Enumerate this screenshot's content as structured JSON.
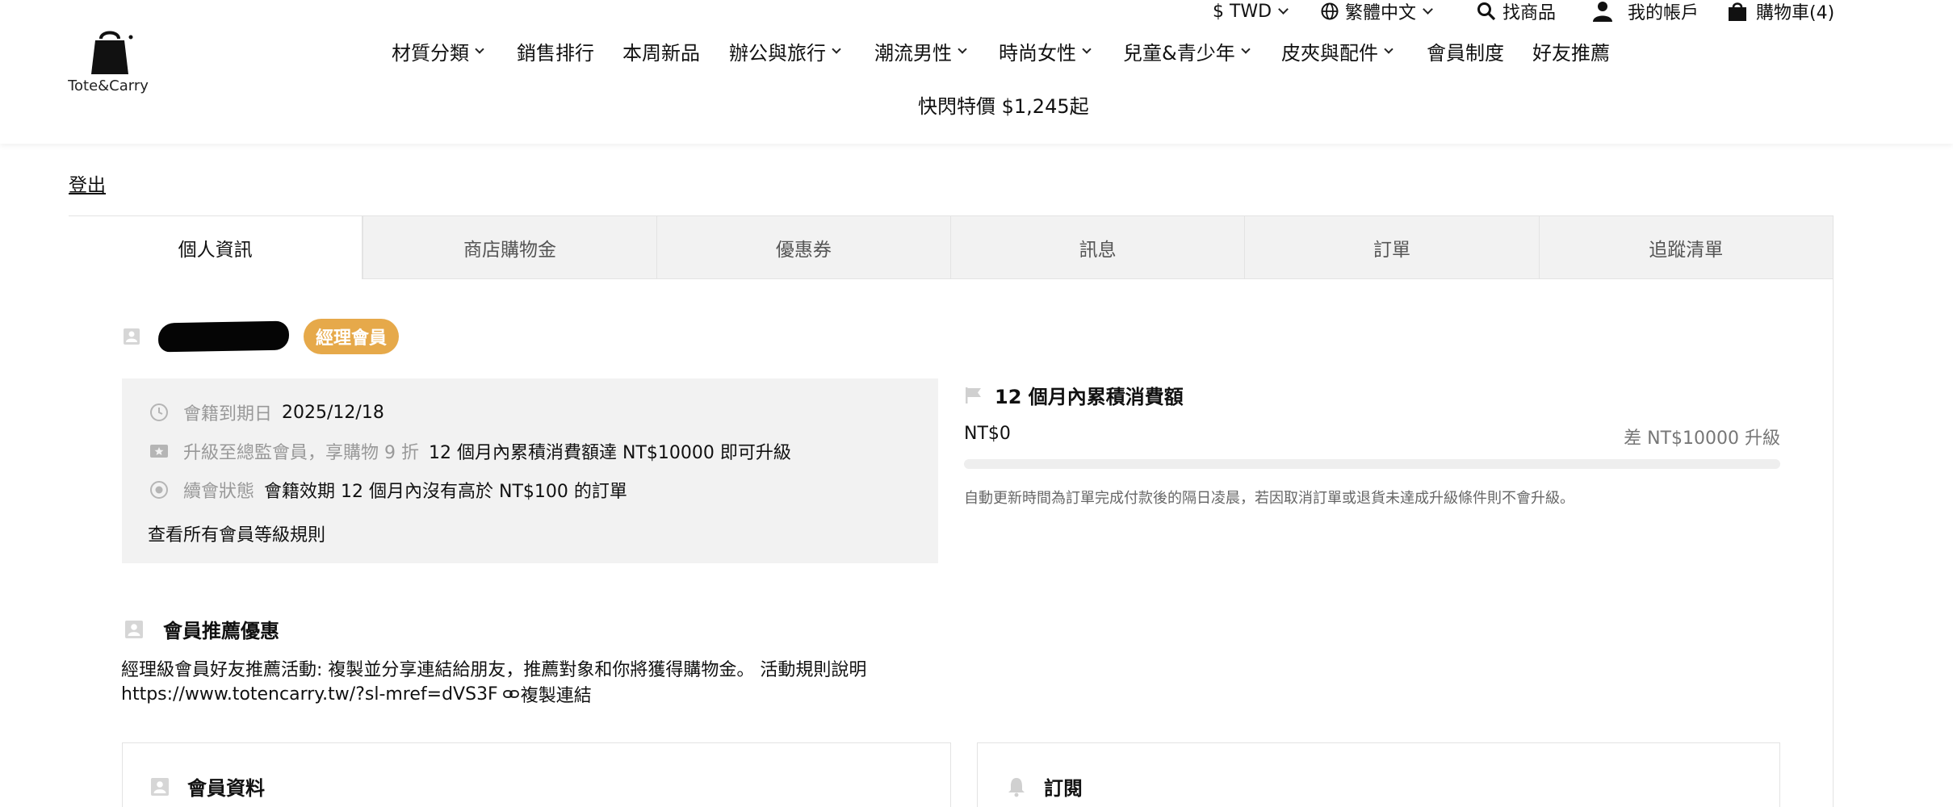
{
  "brand": {
    "name": "Tote&Carry"
  },
  "utility": {
    "currency": "$ TWD",
    "language": "繁體中文",
    "search": "找商品",
    "account": "我的帳戶",
    "cart": "購物車(4)"
  },
  "nav": {
    "items": [
      {
        "label": "材質分類",
        "dropdown": true
      },
      {
        "label": "銷售排行",
        "dropdown": false
      },
      {
        "label": "本周新品",
        "dropdown": false
      },
      {
        "label": "辦公與旅行",
        "dropdown": true
      },
      {
        "label": "潮流男性",
        "dropdown": true
      },
      {
        "label": "時尚女性",
        "dropdown": true
      },
      {
        "label": "兒童&青少年",
        "dropdown": true
      },
      {
        "label": "皮夾與配件",
        "dropdown": true
      },
      {
        "label": "會員制度",
        "dropdown": false
      },
      {
        "label": "好友推薦",
        "dropdown": false
      }
    ],
    "flash_sale": "快閃特價 $1,245起"
  },
  "logout": "登出",
  "tabs": [
    {
      "label": "個人資訊",
      "active": true
    },
    {
      "label": "商店購物金",
      "active": false
    },
    {
      "label": "優惠券",
      "active": false
    },
    {
      "label": "訊息",
      "active": false
    },
    {
      "label": "訂單",
      "active": false
    },
    {
      "label": "追蹤清單",
      "active": false
    }
  ],
  "member": {
    "tier_badge": "經理會員",
    "badge_color": "#e6a94a",
    "expiry_label": "會籍到期日",
    "expiry_value": "2025/12/18",
    "upgrade_label": "升級至總監會員，享購物 9 折",
    "upgrade_value": "12 個月內累積消費額達 NT$10000 即可升級",
    "renew_label": "續會狀態",
    "renew_value": "會籍效期 12 個月內沒有高於 NT$100 的訂單",
    "rules_link": "查看所有會員等級規則"
  },
  "spending": {
    "title": "12 個月內累積消費額",
    "amount": "NT$0",
    "difference": "差 NT$10000 升級",
    "progress": 0,
    "note": "自動更新時間為訂單完成付款後的隔日凌晨，若因取消訂單或退貨未達成升級條件則不會升級。"
  },
  "referral": {
    "title": "會員推薦優惠",
    "description": "經理級會員好友推薦活動: 複製並分享連結給朋友，推薦對象和你將獲得購物金。 活動規則說明",
    "url": "https://www.totencarry.tw/?sl-mref=dVS3F",
    "copy_label": "複製連結"
  },
  "cards": {
    "profile_title": "會員資料",
    "subscribe_title": "訂閱"
  }
}
